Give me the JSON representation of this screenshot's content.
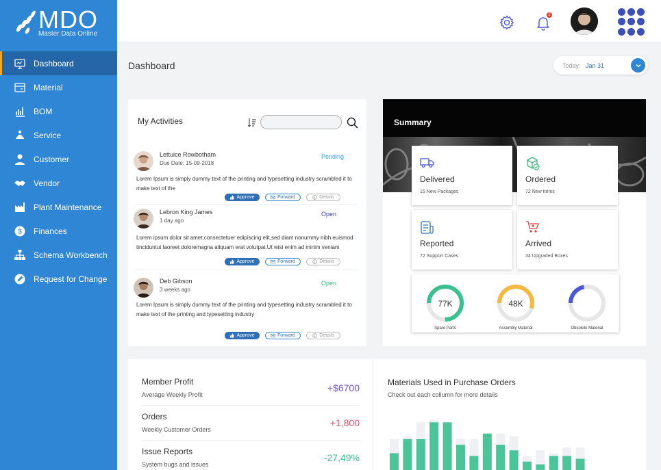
{
  "app": {
    "logo_text": "MDO",
    "logo_sub": "Master Data Online"
  },
  "sidebar": {
    "items": [
      {
        "label": "Dashboard",
        "icon": "monitor-icon",
        "active": true
      },
      {
        "label": "Material",
        "icon": "material-icon"
      },
      {
        "label": "BOM",
        "icon": "bar-chart-icon"
      },
      {
        "label": "Service",
        "icon": "service-icon"
      },
      {
        "label": "Customer",
        "icon": "user-icon"
      },
      {
        "label": "Vendor",
        "icon": "handshake-icon"
      },
      {
        "label": "Plant Maintenance",
        "icon": "factory-icon"
      },
      {
        "label": "Finances",
        "icon": "dollar-icon"
      },
      {
        "label": "Schema Workbench",
        "icon": "hierarchy-icon"
      },
      {
        "label": "Request for Change",
        "icon": "edit-icon"
      }
    ]
  },
  "topbar": {
    "notification_count": "2"
  },
  "page": {
    "title": "Dashboard",
    "date_label": "Today:",
    "date_value": "Jan 31"
  },
  "activities": {
    "title": "My Activities",
    "search_placeholder": "",
    "buttons": {
      "approve": "Approve",
      "forward": "Forward",
      "details": "Details"
    },
    "items": [
      {
        "name": "Lettuice Rowbotham",
        "date": "Due Date:  15-09-2018",
        "status": "Pending",
        "status_color": "#2f9fe0",
        "desc": "Lorem Ipsum is simply dummy text of the printing and typesetting industry scrambled it to make text of the"
      },
      {
        "name": "Lebron King James",
        "date": "1 day ago",
        "status": "Open",
        "status_color": "#3a3fb5",
        "desc": "Lorem ipsum dolor sit amet,consectetuer edipiscing elit,sed diam nonummy nibh euismod tinciduntut laoreet doloremagna aliquam erat volutpat.Ut wisi enim ad minim veniam"
      },
      {
        "name": "Deb Gibson",
        "date": "3 weeks ago",
        "status": "Open",
        "status_color": "#2fb87a",
        "desc": "Lorem Ipsum is simply dummy text of the printing and typesetting industry scrambled it to make text of the printing and typesetting industry"
      }
    ]
  },
  "summary": {
    "title": "Summary",
    "tiles": [
      {
        "label": "Delivered",
        "sub": "15 New Packages",
        "icon": "truck-icon"
      },
      {
        "label": "Ordered",
        "sub": "72 New Items",
        "icon": "package-icon"
      },
      {
        "label": "Reported",
        "sub": "72 Support Cases",
        "icon": "report-icon"
      },
      {
        "label": "Arrived",
        "sub": "34 Upgraded Boxes",
        "icon": "cart-icon"
      }
    ],
    "gauges": [
      {
        "value": "77K",
        "label": "Spare Parts",
        "fraction": 0.75,
        "color": "#3cc08f"
      },
      {
        "value": "48K",
        "label": "Assembly Material",
        "fraction": 0.55,
        "color": "#f5b942"
      },
      {
        "value": "",
        "label": "Obsolete Material",
        "fraction": 0.22,
        "color": "#4b57d8"
      }
    ]
  },
  "stats": [
    {
      "title": "Member Profit",
      "sub": "Average Weekly Profit",
      "value": "+$6700",
      "color": "#6a5acd"
    },
    {
      "title": "Orders",
      "sub": "Weekly Customer Orders",
      "value": "+1,800",
      "color": "#e8506a"
    },
    {
      "title": "Issue Reports",
      "sub": "System bugs and issues",
      "value": "-27,49%",
      "color": "#3cc08f"
    }
  ],
  "chart_data": {
    "type": "bar",
    "title": "Materials Used in Purchase Orders",
    "subtitle": "Check out each collumn for more details",
    "series": [
      {
        "values": [
          6,
          11,
          11,
          17,
          17,
          9,
          5,
          13,
          9,
          7,
          3,
          2,
          5,
          5,
          4
        ]
      },
      {
        "values": [
          11,
          12,
          17,
          18,
          14,
          11,
          11,
          13,
          13,
          12,
          5,
          7,
          6,
          8,
          8
        ]
      }
    ],
    "colors": [
      "#4cc49a",
      "#eef0f3"
    ],
    "ylim": [
      0,
      20
    ]
  }
}
